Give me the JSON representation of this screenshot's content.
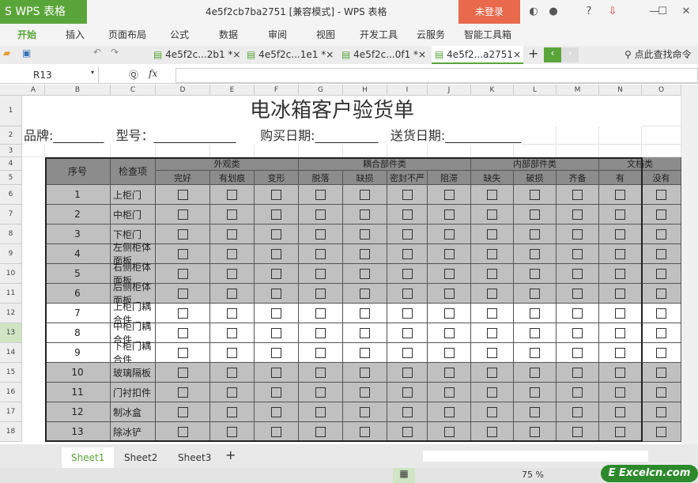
{
  "app": {
    "logo": "S WPS 表格",
    "title": "4e5f2cb7ba2751 [兼容模式] - WPS 表格",
    "login": "未登录"
  },
  "menu": [
    "开始",
    "插入",
    "页面布局",
    "公式",
    "数据",
    "审阅",
    "视图",
    "开发工具",
    "云服务",
    "智能工具箱"
  ],
  "doc_tabs": [
    {
      "label": "4e5f2c...2b1 *×"
    },
    {
      "label": "4e5f2c...1e1 *×"
    },
    {
      "label": "4e5f2c...0f1 *×"
    },
    {
      "label": "4e5f2...a2751×"
    }
  ],
  "search_cmd": "点此查找命令",
  "formula": {
    "namebox": "R13",
    "fx": "fx",
    "value": ""
  },
  "columns": [
    "A",
    "B",
    "C",
    "D",
    "E",
    "F",
    "G",
    "H",
    "I",
    "J",
    "K",
    "L",
    "M",
    "N",
    "O"
  ],
  "rows": [
    "1",
    "2",
    "3",
    "4",
    "5",
    "6",
    "7",
    "8",
    "9",
    "10",
    "11",
    "12",
    "13",
    "14",
    "15",
    "16",
    "17",
    "18"
  ],
  "sheet": {
    "title": "电冰箱客户验货单",
    "info": "品牌:________   型号：_____________      购买日期:__________   送货日期:____________",
    "h_no": "序号",
    "h_item": "检查项",
    "groups": [
      "外观类",
      "耦合部件类",
      "内部部件类",
      "文档类"
    ],
    "subs": [
      "完好",
      "有划痕",
      "变形",
      "脱落",
      "缺损",
      "密封不严",
      "阻滞",
      "缺失",
      "破损",
      "齐备",
      "有",
      "没有"
    ],
    "items": [
      [
        "1",
        "上柜门"
      ],
      [
        "2",
        "中柜门"
      ],
      [
        "3",
        "下柜门"
      ],
      [
        "4",
        "左侧柜体面板"
      ],
      [
        "5",
        "右侧柜体面板"
      ],
      [
        "6",
        "后侧柜体面板"
      ],
      [
        "7",
        "上柜门耦合件"
      ],
      [
        "8",
        "中柜门耦合件"
      ],
      [
        "9",
        "下柜门耦合件"
      ],
      [
        "10",
        "玻璃隔板"
      ],
      [
        "11",
        "门衬扣件"
      ],
      [
        "12",
        "制冰盒"
      ],
      [
        "13",
        "除冰铲"
      ]
    ]
  },
  "sheet_tabs": [
    "Sheet1",
    "Sheet2",
    "Sheet3"
  ],
  "status": {
    "zoom": "75 %",
    "watermark": "Excelcn.com"
  },
  "colors": {
    "accent": "#5aa53a",
    "login": "#e8694c",
    "header_gray": "#8c8c8c",
    "row_gray": "#c0c0c0"
  }
}
